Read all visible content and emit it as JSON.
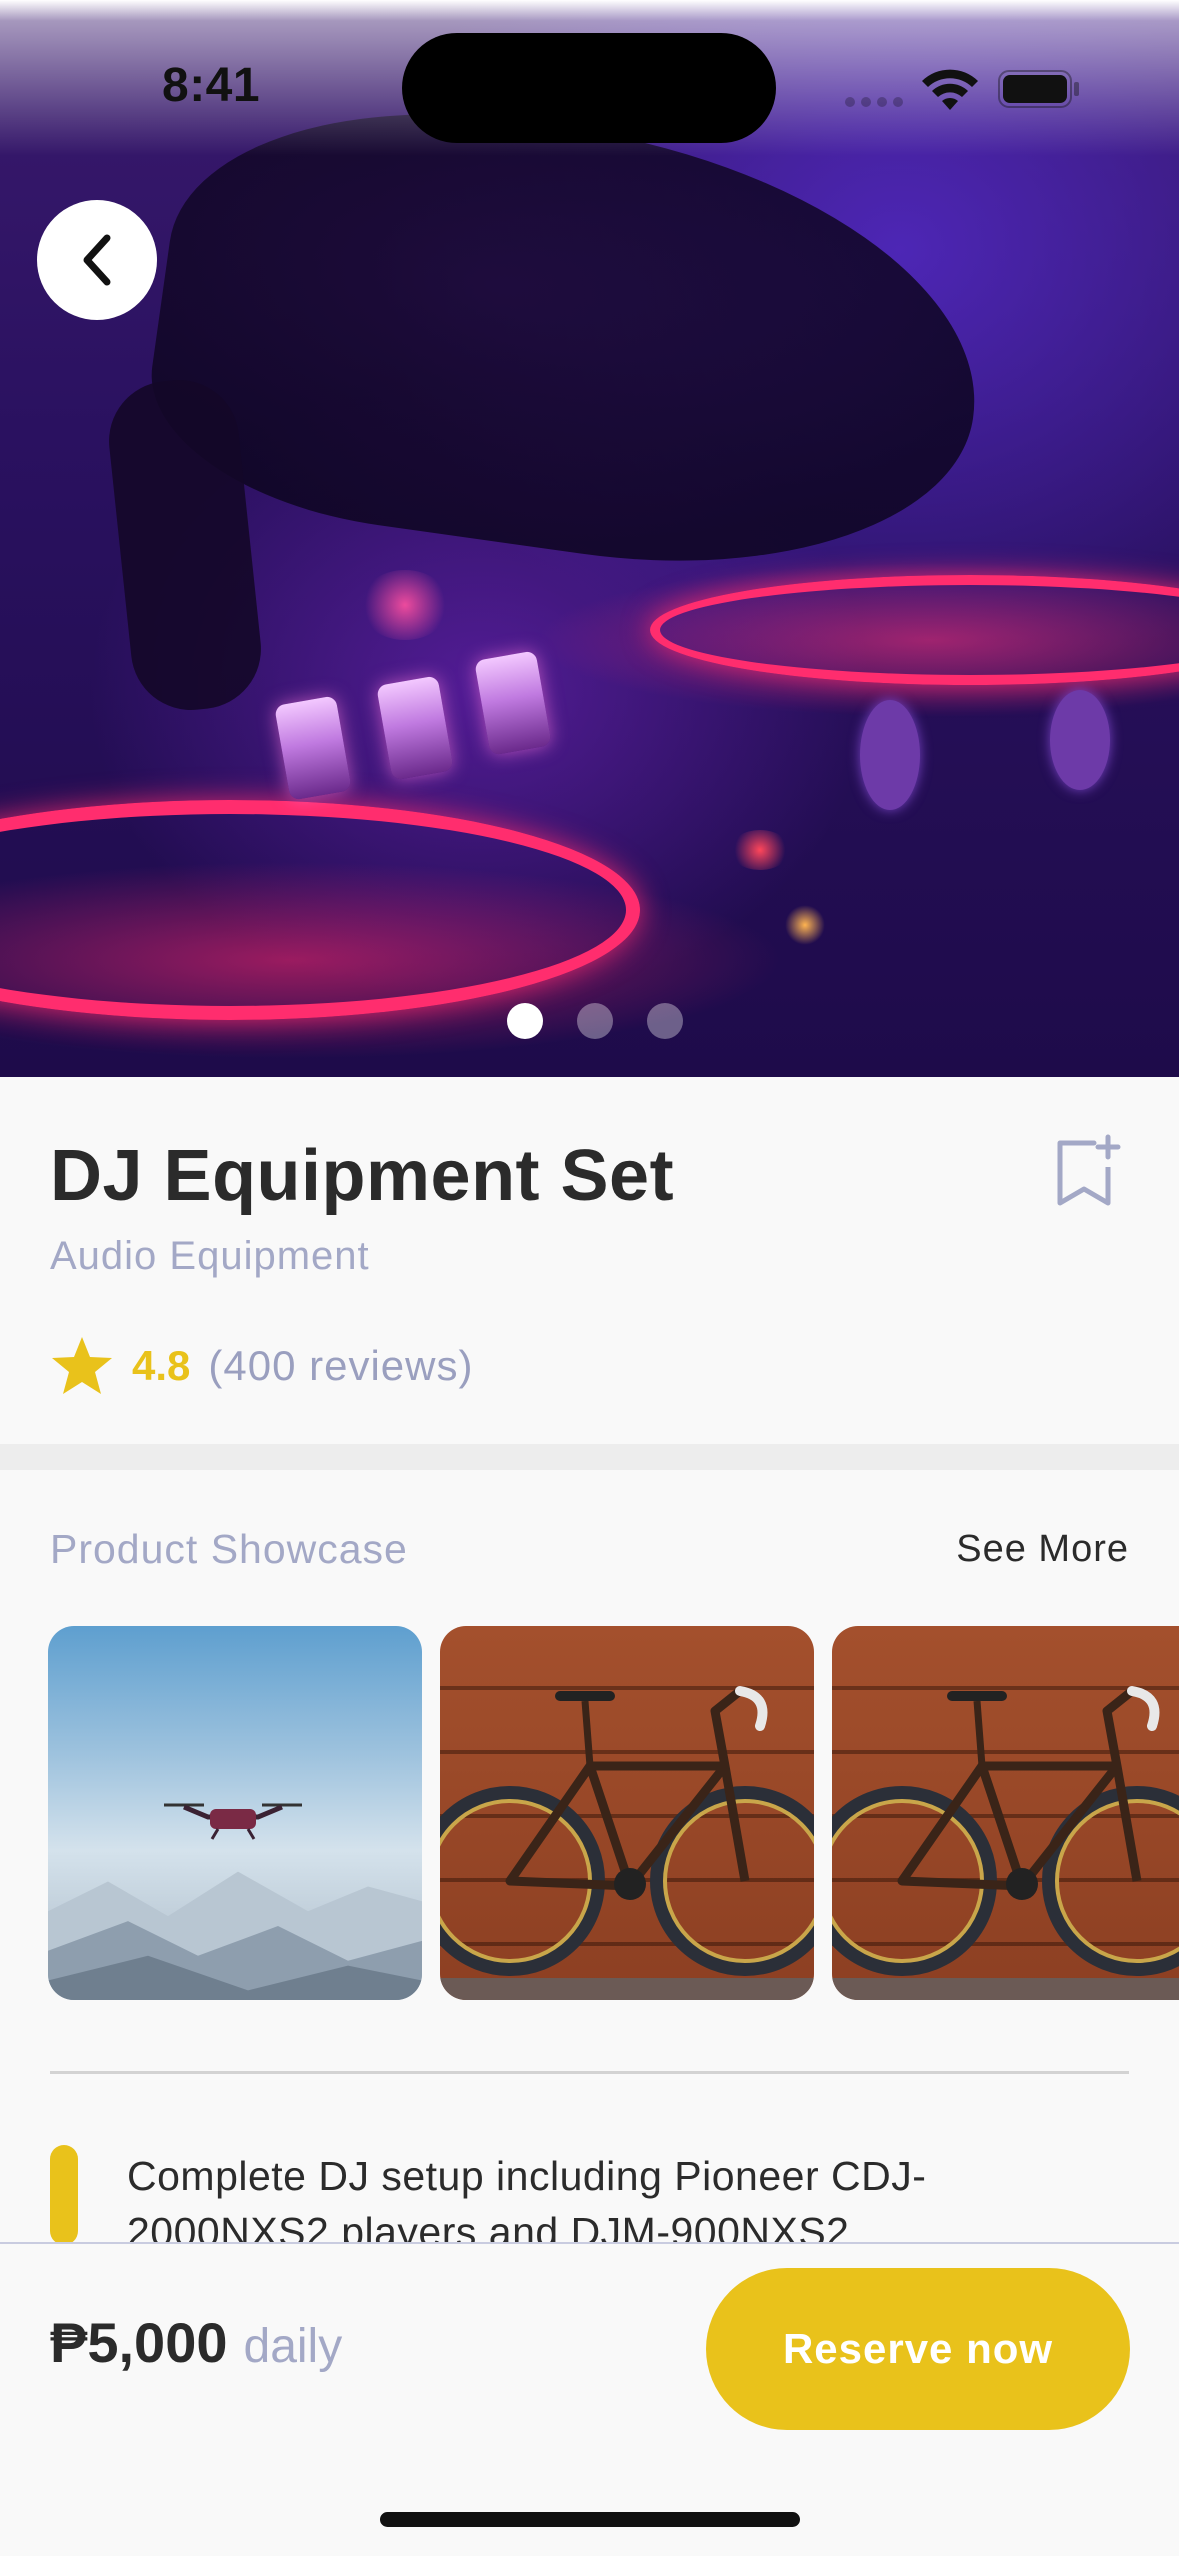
{
  "status_bar": {
    "time": "8:41"
  },
  "hero": {
    "carousel_total": 3,
    "carousel_active": 1
  },
  "product": {
    "title": "DJ Equipment Set",
    "category": "Audio Equipment",
    "rating": "4.8",
    "reviews": "(400 reviews)"
  },
  "showcase": {
    "title": "Product Showcase",
    "see_more": "See More",
    "items": [
      {
        "icon": "drone-photo"
      },
      {
        "icon": "bicycle-photo"
      },
      {
        "icon": "bicycle-photo"
      }
    ]
  },
  "description": {
    "text": "Complete DJ setup including Pioneer CDJ-2000NXS2 players and DJM-900NXS2"
  },
  "booking": {
    "price": "₱5,000",
    "unit": "daily",
    "reserve_label": "Reserve now"
  },
  "colors": {
    "accent": "#E9C21B",
    "muted_text": "#A3A8C6",
    "primary_text": "#2B2B2B"
  }
}
